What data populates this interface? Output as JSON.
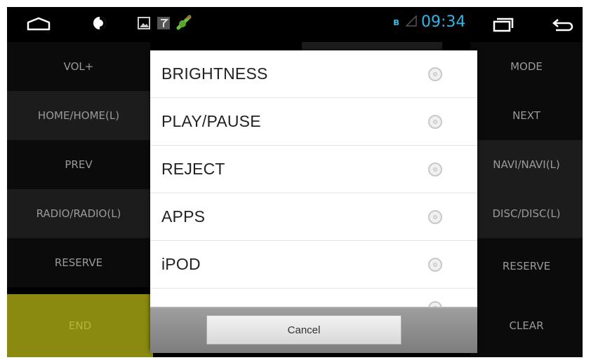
{
  "status_bar": {
    "icons": [
      "home-icon",
      "brightness-icon",
      "image-icon",
      "flag-icon",
      "android-icon"
    ],
    "bluetooth_glyph": "ʙ",
    "time": "09:34",
    "nav_icons": [
      "recent-apps-icon",
      "back-icon"
    ]
  },
  "background_buttons": {
    "left": [
      "VOL+",
      "HOME/HOME(L)",
      "PREV",
      "RADIO/RADIO(L)",
      "RESERVE",
      "END"
    ],
    "right": [
      "MODE",
      "NEXT",
      "NAVI/NAVI(L)",
      "DISC/DISC(L)",
      "RESERVE",
      "CLEAR"
    ]
  },
  "dialog": {
    "options": [
      {
        "label": "BRIGHTNESS"
      },
      {
        "label": "PLAY/PAUSE"
      },
      {
        "label": "REJECT"
      },
      {
        "label": "APPS"
      },
      {
        "label": "iPOD"
      }
    ],
    "cancel_label": "Cancel"
  },
  "colors": {
    "accent": "#33b5e5",
    "end_button": "#8a8a10",
    "dialog_bg": "#ffffff"
  }
}
